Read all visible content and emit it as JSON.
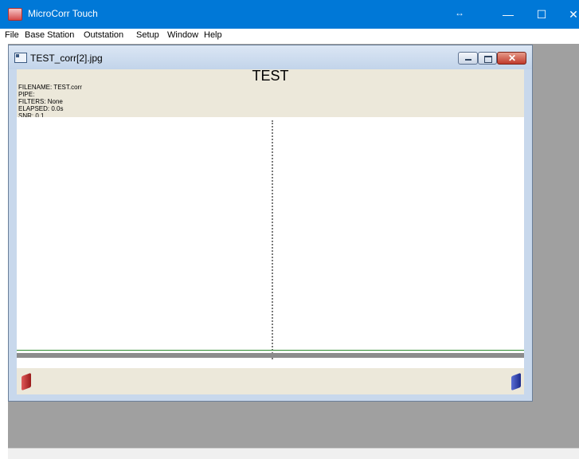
{
  "app": {
    "title": "MicroCorr Touch",
    "resize_indicator": "↔",
    "controls": {
      "minimize": "—",
      "maximize": "☐",
      "close": "✕"
    }
  },
  "menu": [
    "File",
    "Base Station",
    "Outstation",
    "Setup",
    "Window",
    "Help"
  ],
  "child_window": {
    "title": "TEST_corr[2].jpg",
    "controls": {
      "minimize": "",
      "maximize": "",
      "close": "✕"
    }
  },
  "document": {
    "title": "TEST",
    "info": {
      "filename": "FILENAME: TEST.corr",
      "pipe": "PIPE:",
      "filters": "FILTERS: None",
      "elapsed": "ELAPSED: 0.0s",
      "snr": "SNR: 0.1"
    }
  },
  "colors": {
    "titlebar": "#0078d7",
    "mdi_background": "#a0a0a0",
    "header_background": "#ece8da",
    "left_marker": "#c0392b",
    "right_marker": "#2c3e9e"
  },
  "icons": {
    "app": "microcorr-app-icon",
    "child": "image-window-icon",
    "left_marker": "red-sensor-marker-icon",
    "right_marker": "blue-sensor-marker-icon"
  }
}
